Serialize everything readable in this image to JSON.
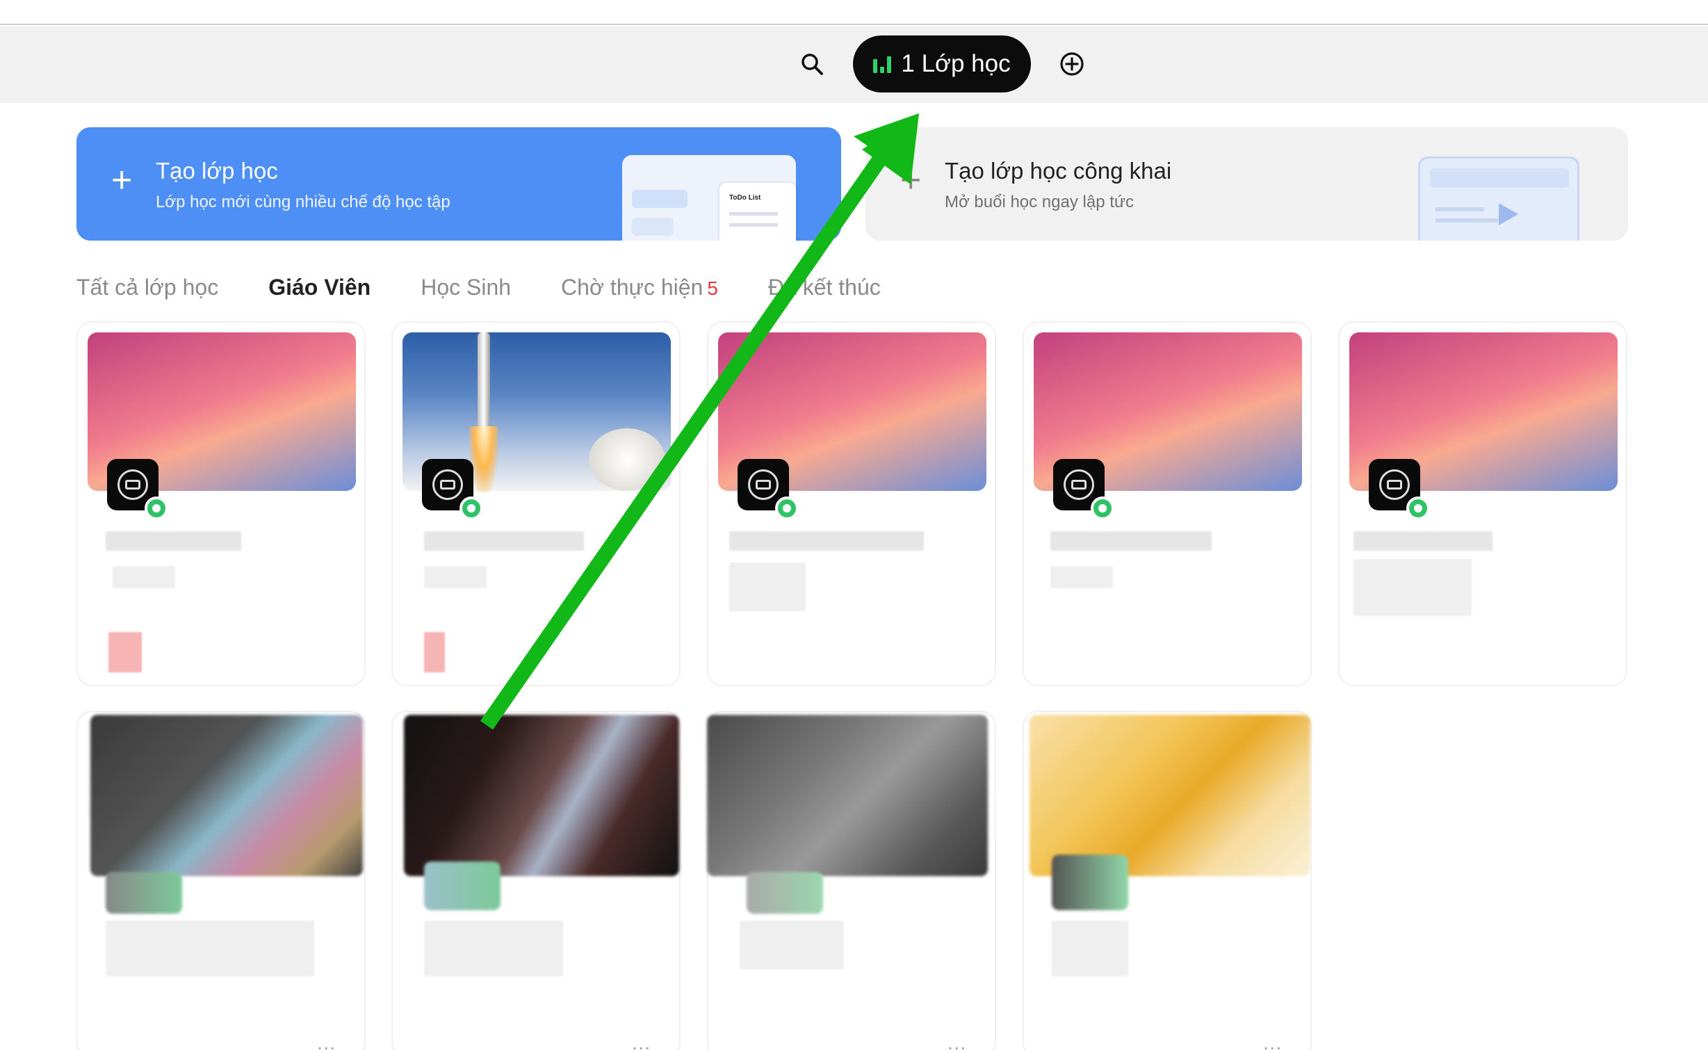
{
  "toolbar": {
    "search_icon": "search-icon",
    "class_pill_label": "1 Lớp học",
    "add_icon": "plus-circle-icon"
  },
  "banners": {
    "create": {
      "title": "Tạo lớp học",
      "subtitle": "Lớp học mới cùng nhiều chế độ học tập",
      "mock_label": "ToDo List"
    },
    "public": {
      "title": "Tạo lớp học công khai",
      "subtitle": "Mở buổi học ngay lập tức"
    }
  },
  "tabs": [
    {
      "label": "Tất cả lớp học"
    },
    {
      "label": "Giáo Viên"
    },
    {
      "label": "Học Sinh"
    },
    {
      "label": "Chờ thực hiện",
      "count": "5"
    },
    {
      "label": "Đã kết thúc"
    }
  ],
  "card_menu": "...",
  "colors": {
    "accent": "#4d8ff5",
    "arrow": "#12b818",
    "online": "#2fc267",
    "pill": "#0c0c0c"
  }
}
